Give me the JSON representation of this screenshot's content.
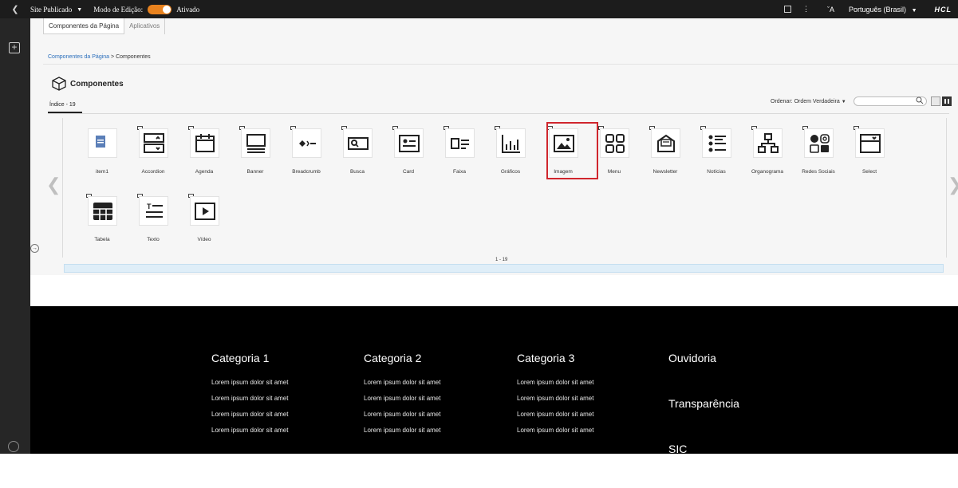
{
  "topbar": {
    "back_icon": "chevron-left-icon",
    "site_status": "Site Publicado",
    "edit_mode_label": "Modo de Edição:",
    "edit_mode_state": "Ativado",
    "toggle_color": "#e8821e",
    "language": "Português (Brasil)",
    "brand": "HCL"
  },
  "tabs": [
    "Componentes da Página",
    "Aplicativos"
  ],
  "breadcrumb": {
    "root": "Componentes da Página",
    "separator": ">",
    "current": "Componentes"
  },
  "panel": {
    "title": "Componentes",
    "index_label": "Índice - 19",
    "sort_label": "Ordenar: Ordem Verdadeira",
    "pager_text": "1 - 19"
  },
  "components": [
    {
      "label": "item1",
      "icon": "document-icon"
    },
    {
      "label": "Accordion",
      "icon": "accordion-icon"
    },
    {
      "label": "Agenda",
      "icon": "calendar-icon"
    },
    {
      "label": "Banner",
      "icon": "banner-icon"
    },
    {
      "label": "Breadcrumb",
      "icon": "breadcrumb-icon"
    },
    {
      "label": "Busca",
      "icon": "search-bar-icon"
    },
    {
      "label": "Card",
      "icon": "card-icon"
    },
    {
      "label": "Faixa",
      "icon": "strip-icon"
    },
    {
      "label": "Gráficos",
      "icon": "chart-icon"
    },
    {
      "label": "Imagem",
      "icon": "image-icon"
    },
    {
      "label": "Menu",
      "icon": "menu-grid-icon"
    },
    {
      "label": "Newsletter",
      "icon": "newsletter-icon"
    },
    {
      "label": "Notícias",
      "icon": "news-list-icon"
    },
    {
      "label": "Organograma",
      "icon": "org-chart-icon"
    },
    {
      "label": "Redes Sociais",
      "icon": "social-icon"
    },
    {
      "label": "Select",
      "icon": "select-icon"
    },
    {
      "label": "Tabela",
      "icon": "table-icon"
    },
    {
      "label": "Texto",
      "icon": "text-icon"
    },
    {
      "label": "Vídeo",
      "icon": "video-icon"
    }
  ],
  "highlight_color": "#d0262d",
  "footer": {
    "columns": [
      {
        "title": "Categoria 1",
        "links": [
          "Lorem ipsum dolor sit amet",
          "Lorem ipsum dolor sit amet",
          "Lorem ipsum dolor sit amet",
          "Lorem ipsum dolor sit amet"
        ]
      },
      {
        "title": "Categoria 2",
        "links": [
          "Lorem ipsum dolor sit amet",
          "Lorem ipsum dolor sit amet",
          "Lorem ipsum dolor sit amet",
          "Lorem ipsum dolor sit amet"
        ]
      },
      {
        "title": "Categoria 3",
        "links": [
          "Lorem ipsum dolor sit amet",
          "Lorem ipsum dolor sit amet",
          "Lorem ipsum dolor sit amet",
          "Lorem ipsum dolor sit amet"
        ]
      }
    ],
    "side_links": [
      "Ouvidoria",
      "Transparência",
      "SIC"
    ]
  }
}
